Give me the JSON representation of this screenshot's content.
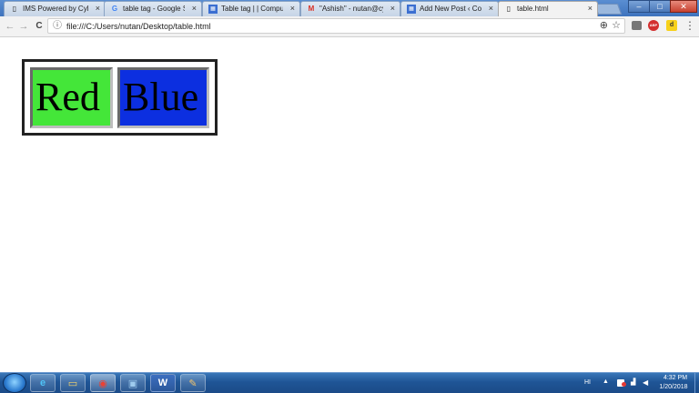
{
  "browser": {
    "tabs": [
      {
        "label": "IMS Powered by Cyber",
        "icon": "document-icon",
        "close": "×"
      },
      {
        "label": "table tag - Google Sea",
        "icon": "google-icon",
        "close": "×"
      },
      {
        "label": "Table tag | | Compute",
        "icon": "blog-icon",
        "close": "×"
      },
      {
        "label": "\"Ashish\" - nutan@cybe",
        "icon": "gmail-icon",
        "close": "×"
      },
      {
        "label": "Add New Post ‹ Comp",
        "icon": "blog-icon",
        "close": "×"
      },
      {
        "label": "table.html",
        "icon": "document-icon",
        "close": "×"
      }
    ],
    "active_tab": 5,
    "address": "file:///C:/Users/nutan/Desktop/table.html",
    "window_controls": {
      "minimize": "–",
      "maximize": "□",
      "close": "✕"
    },
    "nav": {
      "back": "←",
      "forward": "→",
      "reload": "C"
    },
    "omnibox_icons": {
      "info": "ⓘ",
      "zoom": "⊕",
      "star": "☆"
    },
    "extensions": [
      {
        "name": "extension-icon",
        "text": ""
      },
      {
        "name": "adblock-plus-icon",
        "text": "ABP"
      },
      {
        "name": "bookmark-extension-icon",
        "text": "d"
      }
    ],
    "menu": "⋮"
  },
  "page": {
    "table": {
      "cells": [
        {
          "text": "Red",
          "color": "#44e639"
        },
        {
          "text": "Blue",
          "color": "#0c2fe0"
        }
      ]
    }
  },
  "taskbar": {
    "pinned": [
      {
        "name": "internet-explorer-icon",
        "glyph": "e",
        "color": "#4fc3f7"
      },
      {
        "name": "file-explorer-icon",
        "glyph": "▭",
        "color": "#f5d56b"
      },
      {
        "name": "chrome-icon",
        "glyph": "◉",
        "color": "#e94235"
      },
      {
        "name": "generic-app-icon",
        "glyph": "▣",
        "color": "#9ecbee"
      },
      {
        "name": "word-icon",
        "glyph": "W",
        "color": "#2b579a"
      },
      {
        "name": "paint-icon",
        "glyph": "✎",
        "color": "#f0c36d"
      }
    ],
    "language": "HI",
    "time": "4:32 PM",
    "date": "1/20/2018"
  }
}
